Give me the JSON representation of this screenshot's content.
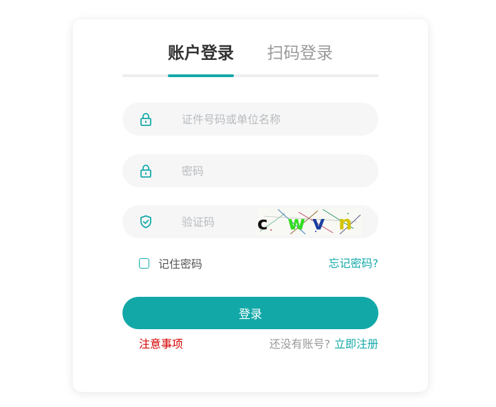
{
  "tabs": {
    "account_login": "账户登录",
    "qr_login": "扫码登录",
    "active": "account_login"
  },
  "form": {
    "account_placeholder": "证件号码或单位名称",
    "password_placeholder": "密码",
    "captcha_placeholder": "验证码",
    "captcha_text": "cwvn",
    "remember_label": "记住密码",
    "remember_checked": false,
    "forgot_link": "忘记密码?",
    "submit_label": "登录"
  },
  "footer": {
    "notice_link": "注意事项",
    "no_account_text": "还没有账号?",
    "register_link": "立即注册"
  },
  "icons": {
    "account": "lock-icon",
    "password": "lock-icon",
    "captcha": "shield-check-icon"
  },
  "colors": {
    "accent": "#13a8a8",
    "notice": "#d60000",
    "field_bg": "#f6f6f6"
  }
}
